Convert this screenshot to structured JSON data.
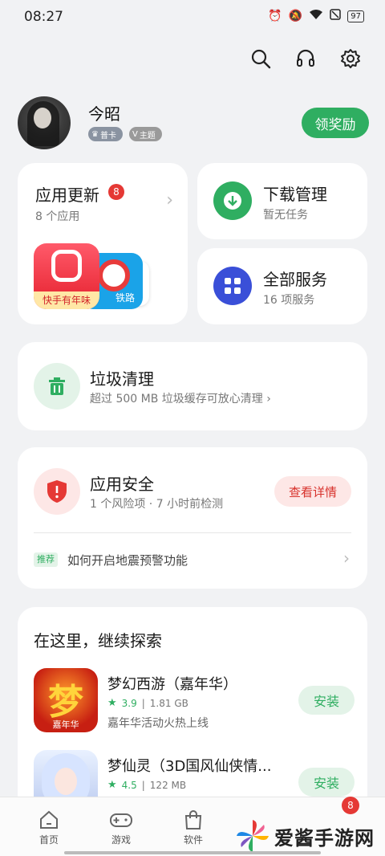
{
  "status": {
    "time": "08:27",
    "battery": "97"
  },
  "profile": {
    "name": "今昭",
    "badges": [
      "普卡",
      "主题"
    ],
    "reward_label": "领奖励"
  },
  "update_card": {
    "title": "应用更新",
    "badge": "8",
    "subtitle": "8 个应用",
    "icon_labels": [
      "快手有年味",
      "铁路"
    ]
  },
  "download_card": {
    "title": "下载管理",
    "subtitle": "暂无任务"
  },
  "services_card": {
    "title": "全部服务",
    "subtitle": "16 项服务"
  },
  "clean_card": {
    "title": "垃圾清理",
    "subtitle": "超过 500 MB 垃圾缓存可放心清理 ›"
  },
  "security_card": {
    "title": "应用安全",
    "subtitle": "1 个风险项 · 7 小时前检测",
    "detail_label": "查看详情",
    "rec_tag": "推荐",
    "rec_text": "如何开启地震预警功能"
  },
  "explore": {
    "title": "在这里，继续探索",
    "install_label": "安装",
    "games": [
      {
        "name": "梦幻西游（嘉年华）",
        "rating": "3.9",
        "size": "1.81 GB",
        "desc": "嘉年华活动火热上线",
        "icon_char": "梦",
        "icon_caption": "嘉年华"
      },
      {
        "name": "梦仙灵（3D国风仙侠情...",
        "rating": "4.5",
        "size": "122 MB",
        "desc": ""
      }
    ]
  },
  "tabs": [
    {
      "label": "首页"
    },
    {
      "label": "游戏"
    },
    {
      "label": "软件"
    }
  ],
  "tab_badge": "8",
  "watermark": "爱酱手游网",
  "colors": {
    "accent_green": "#2fae61",
    "danger_red": "#e53935",
    "services_blue": "#3a4fd8"
  }
}
